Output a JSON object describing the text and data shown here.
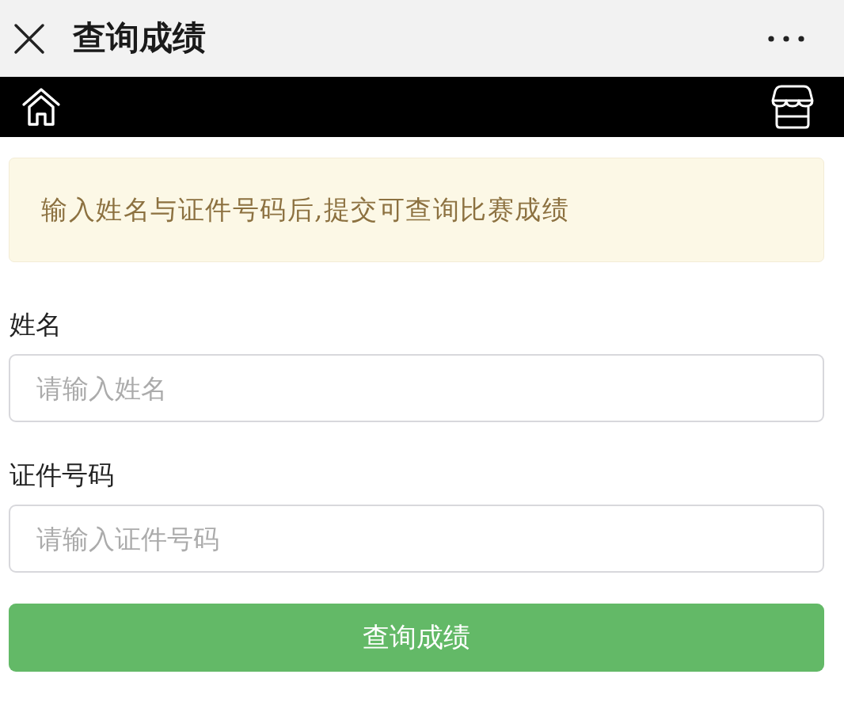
{
  "header": {
    "title": "查询成绩"
  },
  "notice": {
    "text": "输入姓名与证件号码后,提交可查询比赛成绩"
  },
  "fields": [
    {
      "label": "姓名",
      "placeholder": "请输入姓名"
    },
    {
      "label": "证件号码",
      "placeholder": "请输入证件号码"
    }
  ],
  "submit_button": {
    "label": "查询成绩"
  }
}
